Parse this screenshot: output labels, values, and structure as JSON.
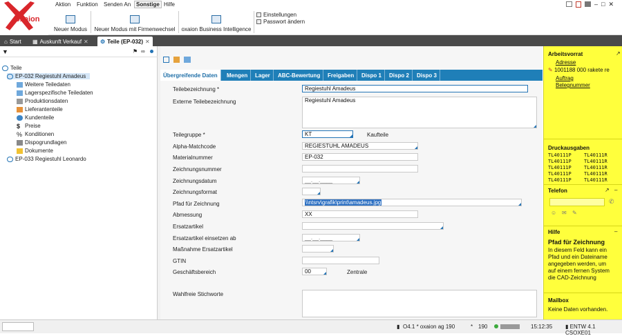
{
  "app": {
    "logo_text": "oxaion"
  },
  "menu": [
    "Aktion",
    "Funktion",
    "Senden An",
    "Sonstige",
    "Hilfe"
  ],
  "ribbon": {
    "buttons": [
      "Neuer Modus",
      "Neuer Modus mit Firmenwechsel",
      "oxaion Business Intelligence"
    ],
    "small": [
      "Einstellungen",
      "Passwort ändern"
    ]
  },
  "tabs": [
    "Start",
    "Auskunft Verkauf",
    "Teile (EP-032)"
  ],
  "tree": {
    "root": "Teile",
    "item1": "EP-032  Regiestuhl Amadeus",
    "children": [
      "Weitere Teiledaten",
      "Lagerspezifische Teiledaten",
      "Produktionsdaten",
      "Lieferantenteile",
      "Kundenteile",
      "Preise",
      "Konditionen",
      "Dispogrundlagen",
      "Dokumente"
    ],
    "item2": "EP-033  Regiestuhl Leonardo"
  },
  "subtabs": [
    "Übergreifende Daten",
    "Mengen",
    "Lager",
    "ABC-Bewertung",
    "Freigaben",
    "Dispo 1",
    "Dispo 2",
    "Dispo 3"
  ],
  "form": {
    "labels": [
      "Teilebezeichnung *",
      "Externe Teilebezeichnung",
      "Teilegruppe *",
      "Alpha-Matchcode",
      "Materialnummer",
      "Zeichnungsnummer",
      "Zeichnungsdatum",
      "Zeichnungsformat",
      "Pfad für Zeichnung",
      "Abmessung",
      "Ersatzartikel",
      "Ersatzartikel einsetzen ab",
      "Maßnahme Ersatzartikel",
      "GTIN",
      "Geschäftsbereich",
      "Wahlfreie Stichworte"
    ],
    "teilebezeichnung": "Regiestuhl Amadeus",
    "externe": "Regiestuhl Amadeus",
    "teilegruppe": "KT",
    "teilegruppe_text": "Kaufteile",
    "alpha": "REGIESTUHL AMADEUS",
    "materialnummer": "EP-032",
    "zeichnungsnummer": "",
    "zeichnungsdatum": "__.__.____",
    "zeichnungsformat": "",
    "pfad": "\\\\ntsrv\\grafik\\print\\amadeus.jpg",
    "abmessung": "XX",
    "ersatzartikel": "",
    "ersatz_ab": "__.__.____",
    "massnahme": "",
    "gtin": "",
    "geschaeftsbereich": "00",
    "geschaeftsbereich_text": "Zentrale",
    "stichworte": ""
  },
  "right": {
    "arbeitsvorrat": "Arbeitsvorrat",
    "links": [
      "Adresse",
      "1001188 000 rakete re",
      "Auftrag",
      "Belegnummer"
    ],
    "druck_title": "Druckausgaben",
    "druck_col1": [
      "TL40111P",
      "TL40111P",
      "TL40111P",
      "TL40111P",
      "TL40111P"
    ],
    "druck_col2": [
      "TL40111R",
      "TL40111R",
      "TL40111R",
      "TL40111R",
      "TL40111R"
    ],
    "telefon": "Telefon",
    "hilfe": "Hilfe",
    "hilfe_sub": "Pfad für Zeichnung",
    "hilfe_text": [
      "In diesem Feld kann ein",
      "Pfad und ein Dateiname",
      "angegeben werden, um",
      "auf einem fernen System",
      "die CAD-Zeichnung"
    ],
    "mailbox": "Mailbox",
    "mailbox_text": "Keine Daten vorhanden."
  },
  "status": {
    "info": "O4.1 * oxaion ag 190",
    "star": "*",
    "num": "190",
    "time": "15:12:35",
    "env": "ENTW 4.1 CSOXE01"
  },
  "colors": {
    "accent": "#1f7fb8",
    "tabbar": "#4a4a4a",
    "panel": "#ffff3c",
    "logo": "#d9262b"
  }
}
